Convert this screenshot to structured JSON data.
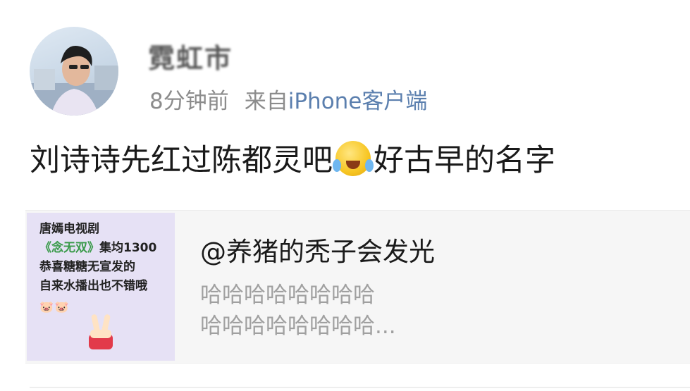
{
  "post": {
    "username": "霓虹市",
    "time": "8分钟前",
    "source_prefix": "来自",
    "source": "iPhone客户端",
    "text_before": "刘诗诗先红过陈都灵吧",
    "emoji": "laughing-crying-emoji",
    "text_after": "好古早的名字"
  },
  "card": {
    "thumbnail": {
      "line1": "唐嫣电视剧",
      "line2_highlight": "《念无双》",
      "line2_rest": "集均1300",
      "line3": "恭喜糖糖无宣发的",
      "line4": "自来水播出也不错哦",
      "line5": "🐷🐷"
    },
    "title": "@养猪的秃子会发光",
    "desc_line1": "哈哈哈哈哈哈哈哈",
    "desc_line2": "哈哈哈哈哈哈哈哈..."
  },
  "colors": {
    "source_link": "#5b7fae",
    "meta_gray": "#8c8c8c",
    "card_bg": "#f6f6f6",
    "thumb_bg": "#e6e1f5"
  }
}
